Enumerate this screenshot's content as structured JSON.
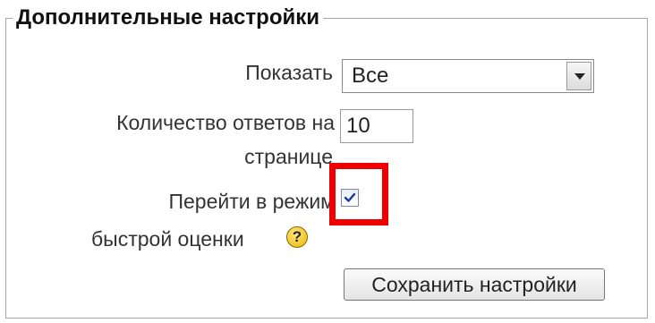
{
  "fieldset": {
    "legend": "Дополнительные настройки"
  },
  "show": {
    "label": "Показать",
    "selected": "Все"
  },
  "per_page": {
    "label_line1": "Количество ответов на",
    "label_line2": "странице",
    "value": "10"
  },
  "quick_grading": {
    "label_line1": "Перейти в режим",
    "label_line2": "быстрой оценки",
    "checked": true,
    "help_icon": "question-mark-help-icon",
    "help_glyph": "?"
  },
  "save_button": {
    "label": "Сохранить настройки"
  },
  "colors": {
    "highlight": "#ee0000",
    "help_icon": "#f5c400"
  }
}
